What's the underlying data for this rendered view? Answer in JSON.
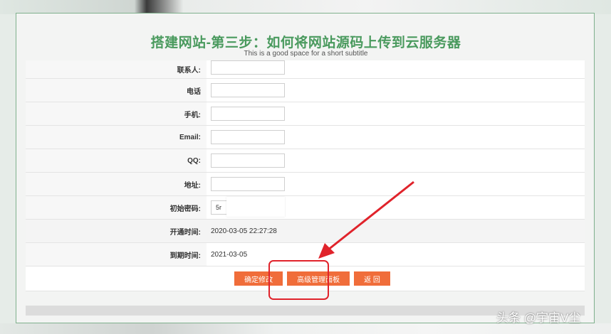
{
  "page": {
    "title": "搭建网站-第三步：如何将网站源码上传到云服务器",
    "subtitle": "This is a good space for a short subtitle"
  },
  "form": {
    "contact_label": "联系人:",
    "phone_label": "电话",
    "mobile_label": "手机:",
    "email_label": "Email:",
    "qq_label": "QQ:",
    "address_label": "地址:",
    "password_label": "初始密码:",
    "password_value": "5r",
    "open_time_label": "开通时间:",
    "open_time_value": "2020-03-05 22:27:28",
    "expire_time_label": "到期时间:",
    "expire_time_value": "2021-03-05"
  },
  "buttons": {
    "confirm": "确定修改",
    "advanced": "高级管理面板",
    "back": "返 回"
  },
  "annotation": {
    "color": "#e0232b"
  },
  "watermark": "头条 @宇宙V尘"
}
